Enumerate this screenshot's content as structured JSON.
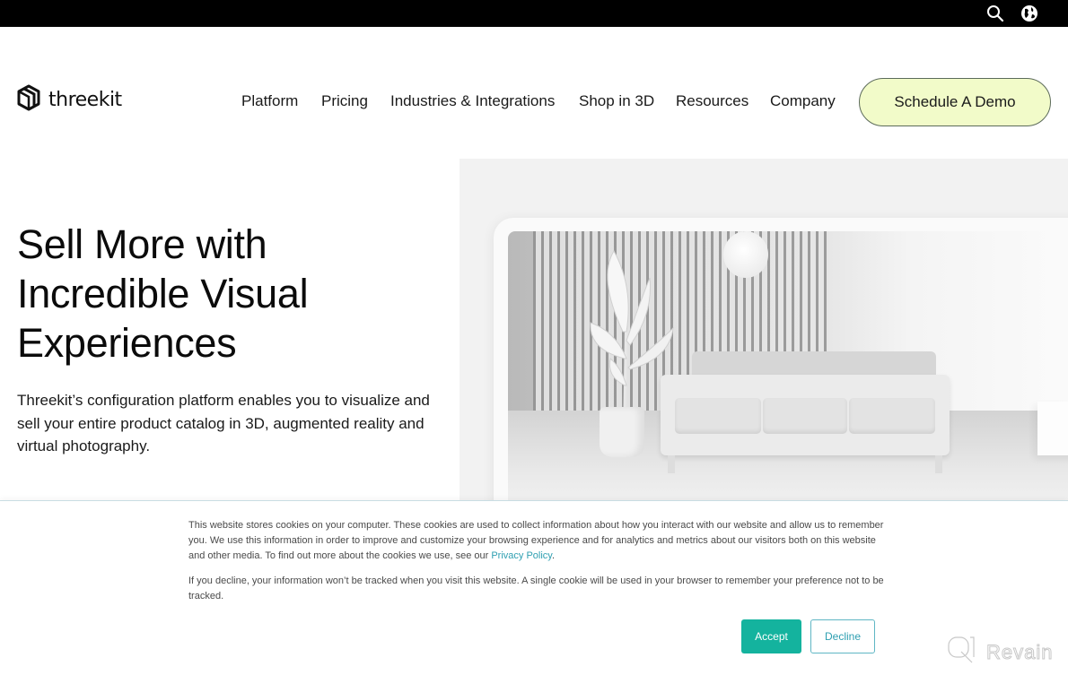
{
  "topbar": {
    "icons": [
      "search-icon",
      "globe-icon"
    ]
  },
  "header": {
    "logo_text": "threekit",
    "nav": [
      {
        "label": "Platform"
      },
      {
        "label": "Pricing"
      },
      {
        "label": "Industries & Integrations"
      },
      {
        "label": "Shop in 3D"
      },
      {
        "label": "Resources"
      },
      {
        "label": "Company"
      }
    ],
    "cta_label": "Schedule A Demo",
    "cta_color": "#f2fbc9"
  },
  "hero": {
    "title_lines": [
      "Sell More with",
      "Incredible Visual",
      "Experiences"
    ],
    "description": "Threekit’s configuration platform enables you to visualize and sell your entire product catalog in 3D, augmented reality and virtual photography.",
    "image_alt": "3D rendered white sofa with plant, pendant lamp and slatted wall"
  },
  "cookie_banner": {
    "paragraph1": "This website stores cookies on your computer. These cookies are used to collect information about how you interact with our website and allow us to remember you. We use this information in order to improve and customize your browsing experience and for analytics and metrics about our visitors both on this website and other media. To find out more about the cookies we use, see our ",
    "privacy_link": "Privacy Policy",
    "paragraph1_end": ".",
    "paragraph2": "If you decline, your information won’t be tracked when you visit this website. A single cookie will be used in your browser to remember your preference not to be tracked.",
    "accept_label": "Accept",
    "decline_label": "Decline",
    "accent_color": "#14b39e"
  },
  "watermark": {
    "text": "Revain"
  }
}
